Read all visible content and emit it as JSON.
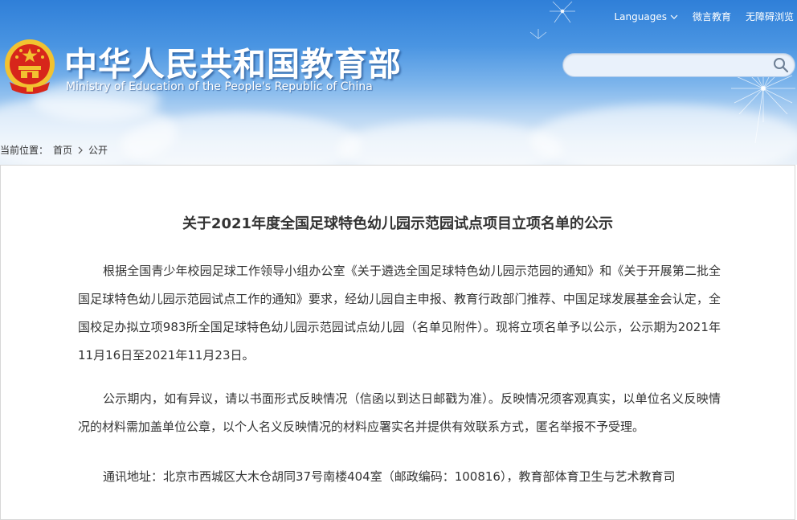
{
  "header": {
    "title_cn": "中华人民共和国教育部",
    "title_en": "Ministry of Education of the People's Republic of China",
    "links": {
      "languages": "Languages",
      "weiyan": "微言教育",
      "accessibility": "无障碍浏览"
    },
    "search": {
      "value": "",
      "placeholder": ""
    },
    "colors": {
      "sky_top": "#2f7fd8",
      "sky_bottom": "#e9f1f9",
      "emblem_red": "#d7261b",
      "emblem_gold": "#f2c230"
    }
  },
  "breadcrumb": {
    "label": "当前位置：",
    "items": [
      "首页",
      "公开"
    ]
  },
  "article": {
    "title": "关于2021年度全国足球特色幼儿园示范园试点项目立项名单的公示",
    "paragraphs": [
      "根据全国青少年校园足球工作领导小组办公室《关于遴选全国足球特色幼儿园示范园的通知》和《关于开展第二批全国足球特色幼儿园示范园试点工作的通知》要求，经幼儿园自主申报、教育行政部门推荐、中国足球发展基金会认定，全国校足办拟立项983所全国足球特色幼儿园示范园试点幼儿园（名单见附件）。现将立项名单予以公示，公示期为2021年11月16日至2021年11月23日。",
      "公示期内，如有异议，请以书面形式反映情况（信函以到达日邮戳为准）。反映情况须客观真实，以单位名义反映情况的材料需加盖单位公章，以个人名义反映情况的材料应署实名并提供有效联系方式，匿名举报不予受理。",
      "通讯地址：北京市西城区大木仓胡同37号南楼404室（邮政编码：100816），教育部体育卫生与艺术教育司"
    ]
  },
  "icons": {
    "emblem": "national-emblem-icon",
    "search": "search-icon",
    "chevron": "chevron-down-icon",
    "breadcrumb_sep": "chevron-right-icon"
  }
}
